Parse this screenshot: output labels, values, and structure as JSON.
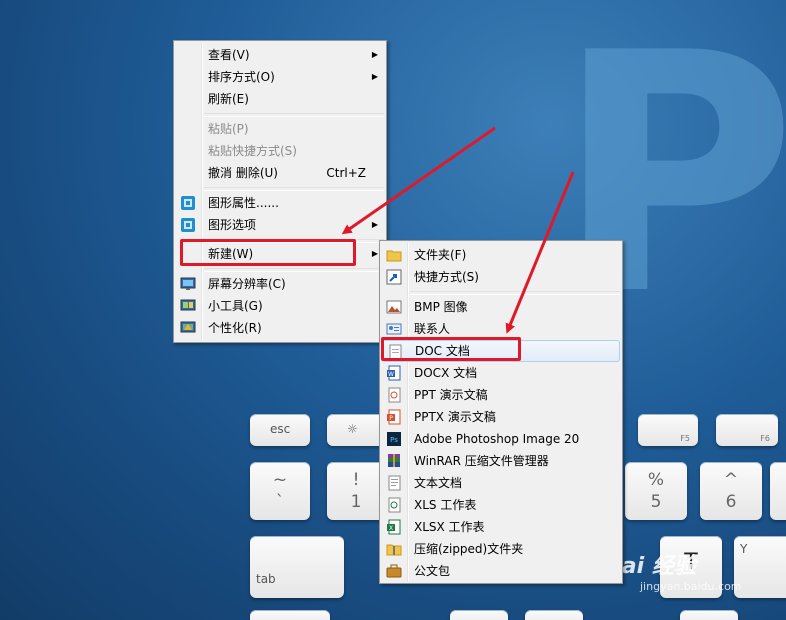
{
  "desktop": {
    "wallpaper_letter": "P",
    "watermark": "Bai 经验",
    "watermark_url": "jingyan.baidu.com"
  },
  "keyboard": {
    "esc": "esc",
    "brightness": "☼",
    "f5": "F5",
    "f6": "F6",
    "tilde_top": "~",
    "tilde_bot": "`",
    "one_top": "!",
    "one_bot": "1",
    "five_top": "%",
    "five_bot": "5",
    "six_top": "^",
    "six_bot": "6",
    "tab": "tab",
    "y": "Y",
    "t": "T"
  },
  "context_menu": {
    "items": [
      {
        "label": "查看(V)",
        "submenu": true
      },
      {
        "label": "排序方式(O)",
        "submenu": true
      },
      {
        "label": "刷新(E)"
      },
      {
        "label": "粘贴(P)",
        "disabled": true
      },
      {
        "label": "粘贴快捷方式(S)",
        "disabled": true
      },
      {
        "label": "撤消 删除(U)",
        "shortcut": "Ctrl+Z"
      },
      {
        "label": "图形属性......",
        "icon": "graphics-properties-icon"
      },
      {
        "label": "图形选项",
        "icon": "graphics-options-icon",
        "submenu": true
      },
      {
        "label": "新建(W)",
        "submenu": true,
        "highlighted": true
      },
      {
        "label": "屏幕分辨率(C)",
        "icon": "screen-resolution-icon"
      },
      {
        "label": "小工具(G)",
        "icon": "gadgets-icon"
      },
      {
        "label": "个性化(R)",
        "icon": "personalize-icon"
      }
    ]
  },
  "new_submenu": {
    "items": [
      {
        "label": "文件夹(F)",
        "icon": "folder-icon"
      },
      {
        "label": "快捷方式(S)",
        "icon": "shortcut-icon"
      },
      {
        "label": "BMP 图像",
        "icon": "bmp-image-icon"
      },
      {
        "label": "联系人",
        "icon": "contact-icon"
      },
      {
        "label": "DOC 文档",
        "icon": "doc-document-icon",
        "hovered": true
      },
      {
        "label": "DOCX 文档",
        "icon": "docx-document-icon"
      },
      {
        "label": "PPT 演示文稿",
        "icon": "ppt-presentation-icon"
      },
      {
        "label": "PPTX 演示文稿",
        "icon": "pptx-presentation-icon"
      },
      {
        "label": "Adobe Photoshop Image 20",
        "icon": "photoshop-image-icon"
      },
      {
        "label": "WinRAR 压缩文件管理器",
        "icon": "winrar-archive-icon"
      },
      {
        "label": "文本文档",
        "icon": "text-document-icon"
      },
      {
        "label": "XLS 工作表",
        "icon": "xls-worksheet-icon"
      },
      {
        "label": "XLSX 工作表",
        "icon": "xlsx-worksheet-icon"
      },
      {
        "label": "压缩(zipped)文件夹",
        "icon": "zip-folder-icon"
      },
      {
        "label": "公文包",
        "icon": "briefcase-icon"
      }
    ]
  },
  "annotation_color": "#e0192a"
}
